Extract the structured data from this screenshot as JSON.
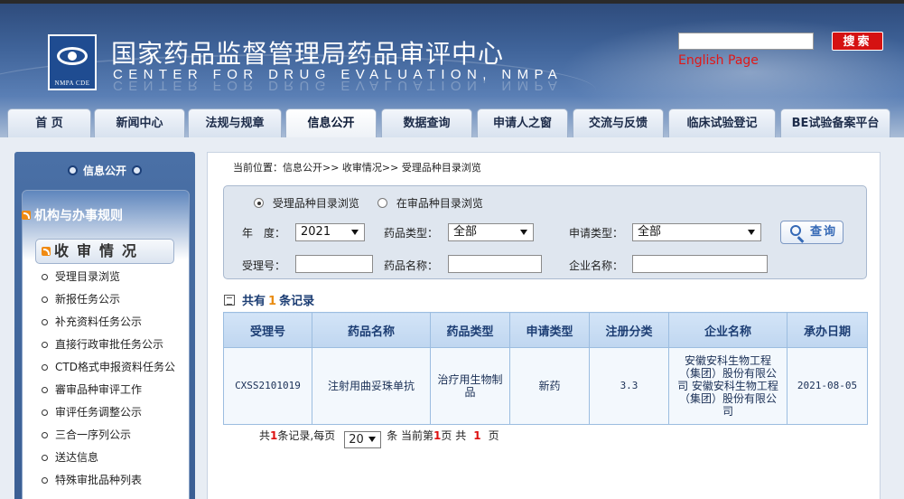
{
  "header": {
    "title": "国家药品监督管理局药品审评中心",
    "subtitle": "CENTER FOR DRUG EVALUATION, NMPA",
    "logo_caption": "NMPA CDE",
    "search_button": "搜索",
    "english_link": "English Page"
  },
  "nav": {
    "tabs": [
      "首 页",
      "新闻中心",
      "法规与规章",
      "信息公开",
      "数据查询",
      "申请人之窗",
      "交流与反馈",
      "临床试验登记",
      "BE试验备案平台"
    ]
  },
  "sidebar": {
    "header": "信息公开",
    "section1": "机构与办事规则",
    "section2": "收审情况",
    "items": [
      "受理目录浏览",
      "新报任务公示",
      "补充资料任务公示",
      "直接行政审批任务公示",
      "CTD格式申报资料任务公",
      "審审品种审评工作",
      "审评任务调整公示",
      "三合一序列公示",
      "送达信息",
      "特殊审批品种列表"
    ]
  },
  "main": {
    "breadcrumb": "当前位置：信息公开>> 收审情况>> 受理品种目录浏览",
    "search": {
      "radio1": "受理品种目录浏览",
      "radio2": "在审品种目录浏览",
      "year_label": "年　度：",
      "year_value": "2021",
      "drug_type_label": "药品类型：",
      "drug_type_value": "全部",
      "apply_type_label": "申请类型：",
      "apply_type_value": "全部",
      "accept_no_label": "受理号：",
      "drug_name_label": "药品名称：",
      "company_label": "企业名称：",
      "query_button": "查询"
    },
    "records": {
      "prefix": "共有",
      "count": "1",
      "suffix": "条记录"
    },
    "table": {
      "headers": [
        "受理号",
        "药品名称",
        "药品类型",
        "申请类型",
        "注册分类",
        "企业名称",
        "承办日期"
      ],
      "rows": [
        [
          "CXSS2101019",
          "注射用曲妥珠单抗",
          "治疗用生物制品",
          "新药",
          "3.3",
          "安徽安科生物工程（集团）股份有限公司 安徽安科生物工程（集团）股份有限公司",
          "2021-08-05"
        ]
      ]
    },
    "pager": {
      "p1": "共",
      "total": "1",
      "p2": "条记录,每页",
      "page_size": "20",
      "p3": "条 当前第",
      "current": "1",
      "p4": "页 共",
      "pages": "1",
      "p5": "页"
    }
  }
}
